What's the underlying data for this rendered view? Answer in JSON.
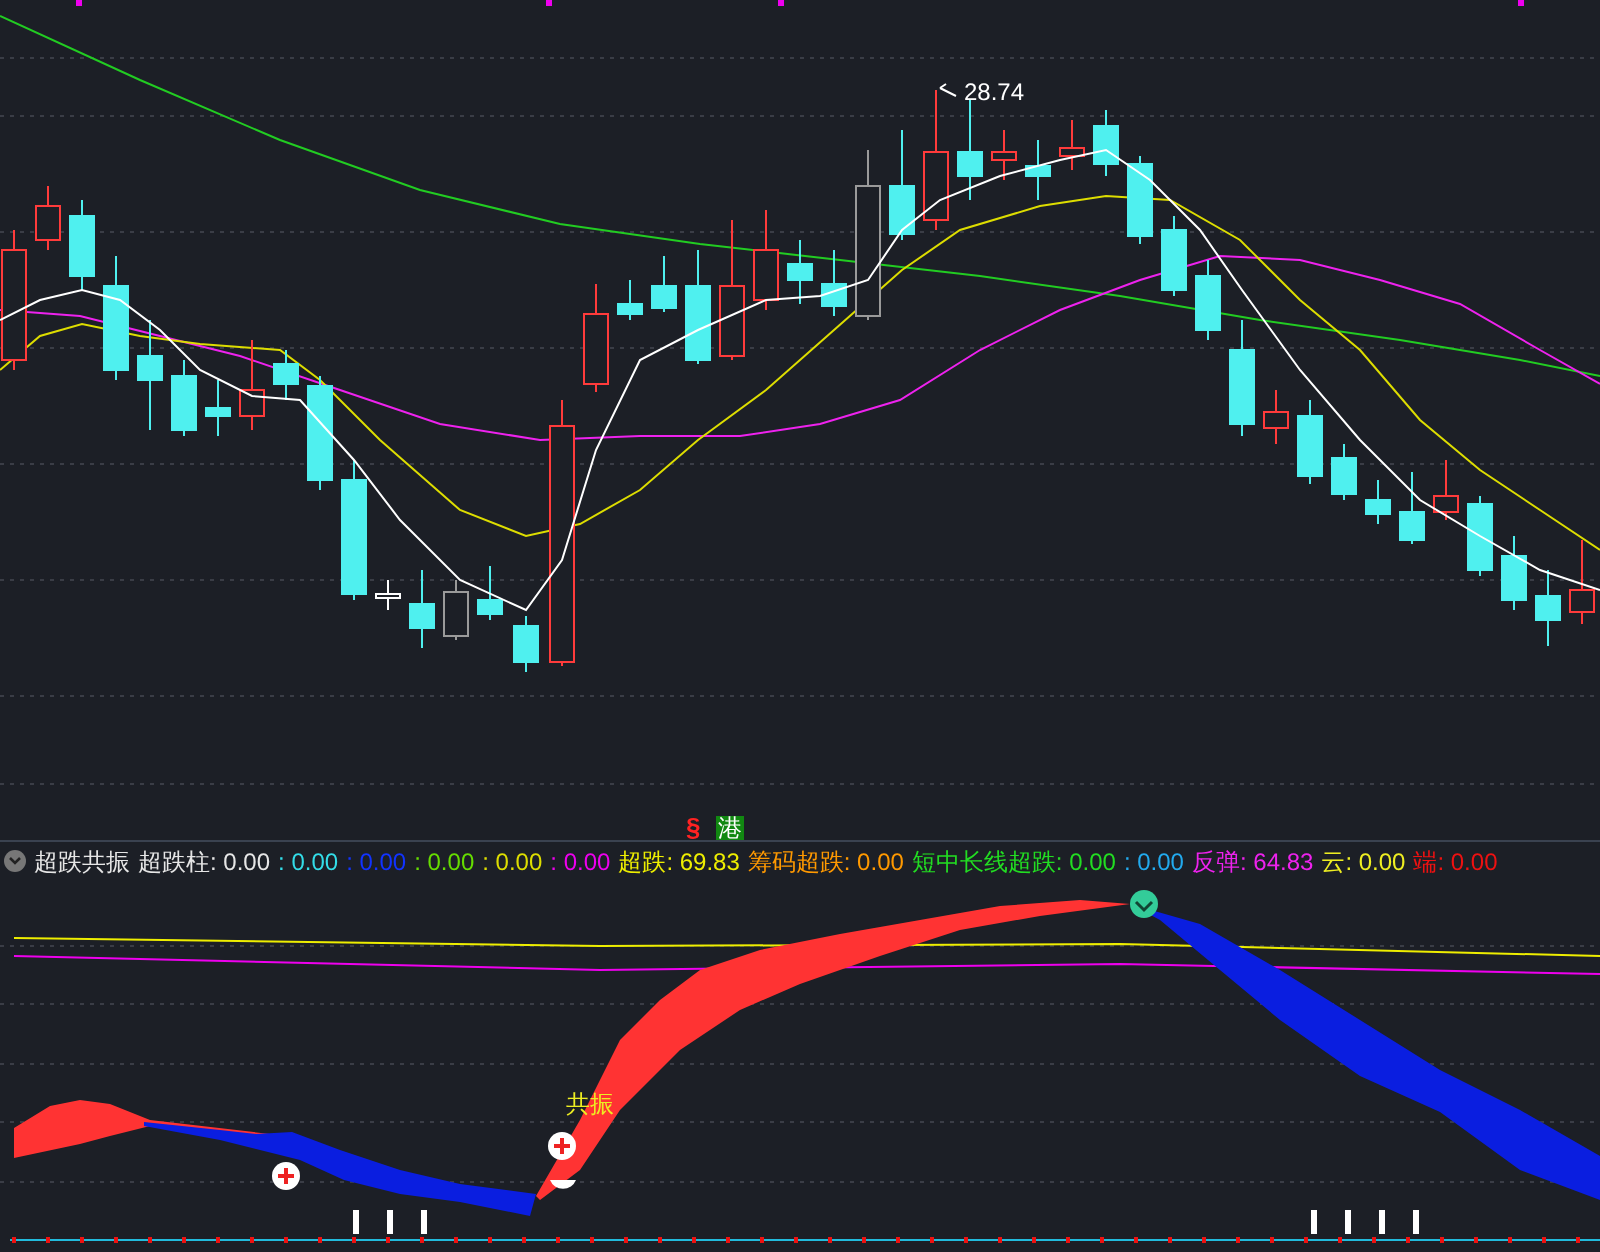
{
  "main_chart": {
    "price_label": "28.74",
    "markers": [
      {
        "kind": "risk",
        "text": "§"
      },
      {
        "kind": "hk",
        "text": "港"
      }
    ]
  },
  "indicator": {
    "title": "超跌共振",
    "readouts": [
      {
        "label": "超跌柱:",
        "value": "0.00",
        "color": "#e6e6e6"
      },
      {
        "label": ":",
        "value": "0.00",
        "color": "#33dde8"
      },
      {
        "label": ":",
        "value": "0.00",
        "color": "#1133ff"
      },
      {
        "label": ":",
        "value": "0.00",
        "color": "#66dd00"
      },
      {
        "label": ":",
        "value": "0.00",
        "color": "#dddd00"
      },
      {
        "label": ":",
        "value": "0.00",
        "color": "#ee00ee"
      },
      {
        "label": "超跌:",
        "value": "69.83",
        "color": "#eeee00"
      },
      {
        "label": "筹码超跌:",
        "value": "0.00",
        "color": "#ff9900"
      },
      {
        "label": "短中长线超跌:",
        "value": "0.00",
        "color": "#22dd22"
      },
      {
        "label": ":",
        "value": "0.00",
        "color": "#22aaee"
      },
      {
        "label": "反弹:",
        "value": "64.83",
        "color": "#ee22ee"
      },
      {
        "label": "云:",
        "value": "0.00",
        "color": "#eeee22"
      },
      {
        "label": "端:",
        "value": "0.00",
        "color": "#ee1111"
      }
    ],
    "signal_label": "共振"
  }
}
